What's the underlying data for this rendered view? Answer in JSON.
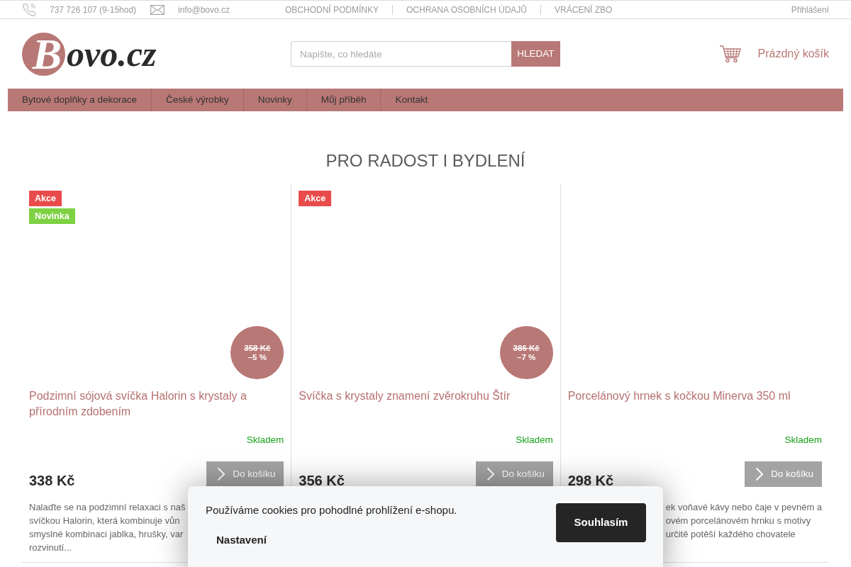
{
  "top_bar": {
    "phone": "737 726 107 (9-15hod)",
    "email": "info@bovo.cz",
    "links": [
      "OBCHODNÍ PODMÍNKY",
      "OCHRANA OSOBNÍCH ÚDAJŮ",
      "VRÁCENÍ ZBO"
    ],
    "login": "Přihlášení"
  },
  "header": {
    "logo": "Bovo.cz",
    "search": {
      "placeholder": "Napište, co hledáte",
      "button": "HLEDAT"
    },
    "cart": "Prázdný košík"
  },
  "menu": [
    "Bytové doplňky a dekorace",
    "České výrobky",
    "Novinky",
    "Můj příběh",
    "Kontakt"
  ],
  "section_title": "PRO RADOST I BYDLENÍ",
  "products": [
    {
      "flags": [
        {
          "label": "Akce",
          "color": "#e94b4b"
        },
        {
          "label": "Novinka",
          "color": "#7dd143"
        }
      ],
      "old_price": "358 Kč",
      "discount": "–5 %",
      "name": "Podzimní sójová svíčka Halorin s krystaly a přírodním zdobením",
      "availability": "Skladem",
      "price": "338 Kč",
      "cart_button": "Do košíku",
      "description_lines": [
        "Nalaďte se na podzimní relaxaci s naš",
        "svíčkou Halorin, která kombinuje vůn",
        "smyslné kombinaci jablka, hrušky, var",
        "rozvinutí..."
      ]
    },
    {
      "flags": [
        {
          "label": "Akce",
          "color": "#e94b4b"
        }
      ],
      "old_price": "386 Kč",
      "discount": "–7 %",
      "name": "Svíčka s krystaly znamení zvěrokruhu Štír",
      "availability": "Skladem",
      "price": "356 Kč",
      "cart_button": "Do košíku"
    },
    {
      "name": "Porcelánový hrnek s kočkou Minerva 350 ml",
      "availability": "Skladem",
      "price": "298 Kč",
      "cart_button": "Do košíku",
      "description_lines": [
        "ek voňavé kávy nebo čaje v pevném a",
        "ovém porcelánovém hrnku s motivy",
        "určitě potěší každého chovatele"
      ]
    }
  ],
  "cookie_bar": {
    "text": "Používáme cookies pro pohodlné prohlížení e-shopu.",
    "settings": "Nastavení",
    "accept": "Souhlasím"
  }
}
